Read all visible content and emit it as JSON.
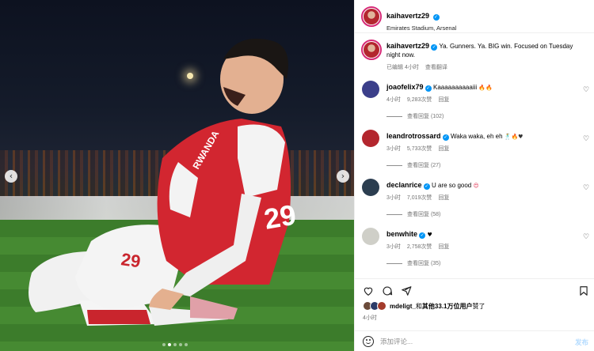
{
  "post": {
    "username": "kaihavertz29",
    "location": "Emirates Stadium, Arsenal",
    "caption": "Ya. Gunners. Ya. BIG win. Focused on Tuesday night now.",
    "caption_edited": "已编辑",
    "caption_time": "4小时",
    "caption_translate": "查看翻译",
    "likes_by": "mdeligt_",
    "likes_mid": "和",
    "likes_others": "其他33.1万位用户",
    "likes_suffix": "赞了",
    "time": "4小时",
    "add_comment_placeholder": "添加评论...",
    "post_label": "发布"
  },
  "comments": [
    {
      "username": "joaofelix79",
      "text": "Kaaaaaaaaaaiii",
      "emoji": "🔥🔥",
      "time": "4小时",
      "likes": "9,283次赞",
      "reply": "回复",
      "view_replies": "查看回复 (102)",
      "avatar_color": "#3b3f8a"
    },
    {
      "username": "leandrotrossard",
      "text": "Waka waka, eh eh",
      "emoji": "🕺🔥♥",
      "time": "3小时",
      "likes": "5,733次赞",
      "reply": "回复",
      "view_replies": "查看回复 (27)",
      "avatar_color": "#b3262e"
    },
    {
      "username": "declanrice",
      "text": "U are so good",
      "emoji": "😍",
      "time": "3小时",
      "likes": "7,019次赞",
      "reply": "回复",
      "view_replies": "查看回复 (58)",
      "avatar_color": "#2c3e50"
    },
    {
      "username": "benwhite",
      "text": "",
      "emoji": "♥",
      "time": "3小时",
      "likes": "2,758次赞",
      "reply": "回复",
      "view_replies": "查看回复 (35)",
      "avatar_color": "#cfcfc8"
    }
  ],
  "icons": {
    "verified": "verified-icon",
    "heart": "heart-icon",
    "comment": "comment-icon",
    "share": "share-icon",
    "bookmark": "bookmark-icon",
    "emoji": "emoji-icon",
    "prev": "chevron-left-icon",
    "next": "chevron-right-icon"
  },
  "carousel": {
    "total": 5,
    "current": 2
  },
  "colors": {
    "accent": "#0095f6",
    "story_ring": "#d62976",
    "jersey_red": "#d22630"
  }
}
